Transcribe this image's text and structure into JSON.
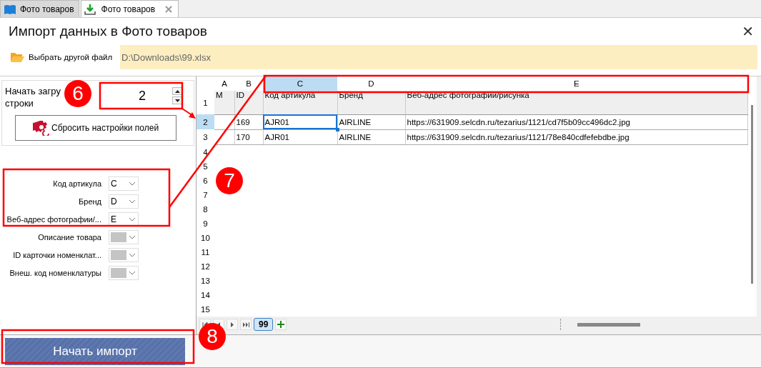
{
  "tabs": [
    {
      "label": "Фото товаров",
      "selected": false,
      "closable": false
    },
    {
      "label": "Фото товаров",
      "selected": true,
      "closable": true
    }
  ],
  "window": {
    "title": "Импорт данных в Фото товаров",
    "close": "✕"
  },
  "file_bar": {
    "button": "Выбрать другой файл",
    "path": "D:\\Downloads\\99.xlsx"
  },
  "start_row": {
    "label_line_1": "Начать загру",
    "label_line_2": "строки",
    "value": "2",
    "reset_button": "Сбросить  настройки  полей"
  },
  "mappings": [
    {
      "label": "Код артикула",
      "value": "C",
      "disabled": false
    },
    {
      "label": "Бренд",
      "value": "D",
      "disabled": false
    },
    {
      "label": "Веб-адрес фотографии/...",
      "value": "E",
      "disabled": false
    },
    {
      "label": "Описание товара",
      "disabled": true
    },
    {
      "label": "ID карточки номенклат...",
      "disabled": true
    },
    {
      "label": "Внеш. код номенклатуры",
      "disabled": true
    }
  ],
  "grid": {
    "columns": [
      {
        "letter": "A",
        "selected": false
      },
      {
        "letter": "B",
        "selected": false
      },
      {
        "letter": "C",
        "selected": true
      },
      {
        "letter": "D",
        "selected": false
      },
      {
        "letter": "E",
        "selected": false
      }
    ],
    "rows": [
      {
        "number": "1",
        "selected": false,
        "kind": "header",
        "cells": [
          "M",
          "ID",
          "Код артикула",
          "Бренд",
          "Веб-адрес фотографии/рисунка"
        ]
      },
      {
        "number": "2",
        "selected": true,
        "kind": "data",
        "cells": [
          {
            "text": "",
            "selected": false
          },
          {
            "text": "169",
            "selected": false
          },
          {
            "text": "AJR01",
            "selected": true
          },
          {
            "text": "AIRLINE",
            "selected": false
          },
          {
            "text": "https://631909.selcdn.ru/tezarius/1121/cd7f5b09cc496dc2.jpg",
            "selected": false
          }
        ]
      },
      {
        "number": "3",
        "selected": false,
        "kind": "data",
        "cells": [
          {
            "text": "",
            "selected": false
          },
          {
            "text": "170",
            "selected": false
          },
          {
            "text": "AJR01",
            "selected": false
          },
          {
            "text": "AIRLINE",
            "selected": false
          },
          {
            "text": "https://631909.selcdn.ru/tezarius/1121/78e840cdfefebdbe.jpg",
            "selected": false
          }
        ]
      },
      {
        "number": "4",
        "selected": false,
        "kind": "empty"
      },
      {
        "number": "5",
        "selected": false,
        "kind": "empty"
      },
      {
        "number": "6",
        "selected": false,
        "kind": "empty"
      },
      {
        "number": "7",
        "selected": false,
        "kind": "empty"
      },
      {
        "number": "8",
        "selected": false,
        "kind": "empty"
      },
      {
        "number": "9",
        "selected": false,
        "kind": "empty"
      },
      {
        "number": "10",
        "selected": false,
        "kind": "empty"
      },
      {
        "number": "11",
        "selected": false,
        "kind": "empty"
      },
      {
        "number": "12",
        "selected": false,
        "kind": "empty"
      },
      {
        "number": "13",
        "selected": false,
        "kind": "empty"
      },
      {
        "number": "14",
        "selected": false,
        "kind": "empty"
      },
      {
        "number": "15",
        "selected": false,
        "kind": "empty"
      }
    ],
    "sheets": [
      {
        "label": "99",
        "selected": true
      }
    ]
  },
  "import_button": "Начать импорт",
  "annotations": [
    {
      "label": "6"
    },
    {
      "label": "7"
    },
    {
      "label": "8"
    }
  ]
}
